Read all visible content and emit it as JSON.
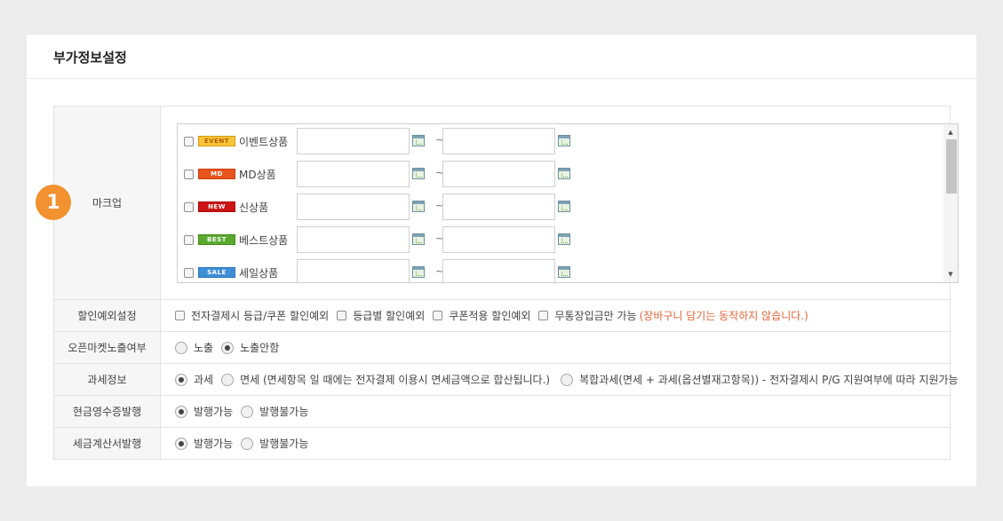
{
  "panel": {
    "title": "부가정보설정"
  },
  "step_badge": "1",
  "markup": {
    "label": "마크업",
    "tilde": "~",
    "items": [
      {
        "tag": "EVENT",
        "name": "이벤트상품",
        "tag_bg": "#f7c43a",
        "tag_color": "#b55a00",
        "tag_border": "#d99a10"
      },
      {
        "tag": "MD",
        "name": "MD상품",
        "tag_bg": "#e8541d",
        "tag_color": "#ffffff",
        "tag_border": "#c9400f"
      },
      {
        "tag": "NEW",
        "name": "신상품",
        "tag_bg": "#cc1414",
        "tag_color": "#ffffff",
        "tag_border": "#a80c0c"
      },
      {
        "tag": "BEST",
        "name": "베스트상품",
        "tag_bg": "#5aaa2e",
        "tag_color": "#ffffff",
        "tag_border": "#428a1c"
      },
      {
        "tag": "SALE",
        "name": "세일상품",
        "tag_bg": "#3f8fd6",
        "tag_color": "#ffffff",
        "tag_border": "#2c74b8"
      }
    ]
  },
  "discount": {
    "label": "할인예외설정",
    "options": [
      "전자결제시 등급/쿠폰 할인예외",
      "등급별 할인예외",
      "쿠폰적용 할인예외",
      "무통장입금만 가능"
    ],
    "warning": "(장바구니 담기는 동작하지 않습니다.)"
  },
  "open_market": {
    "label": "오픈마켓노출여부",
    "options": [
      "노출",
      "노출안함"
    ],
    "selected": 1
  },
  "tax": {
    "label": "과세정보",
    "options": [
      "과세",
      "면세 (면세항목 일 때에는 전자결제 이용시 면세금액으로 합산됩니다.)",
      "복합과세(면세 + 과세(옵션별재고항목)) - 전자결제시 P/G 지원여부에 따라 지원가능"
    ],
    "selected": 0
  },
  "cash_receipt": {
    "label": "현금영수증발행",
    "options": [
      "발행가능",
      "발행불가능"
    ],
    "selected": 0
  },
  "tax_invoice": {
    "label": "세금계산서발행",
    "options": [
      "발행가능",
      "발행불가능"
    ],
    "selected": 0
  }
}
